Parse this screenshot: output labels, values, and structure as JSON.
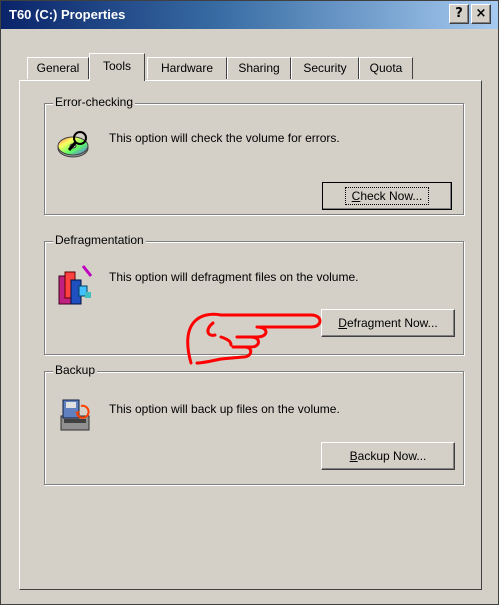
{
  "window": {
    "title": "T60 (C:) Properties"
  },
  "title_buttons": {
    "help": "?",
    "close": "×"
  },
  "tabs": [
    {
      "label": "General"
    },
    {
      "label": "Tools"
    },
    {
      "label": "Hardware"
    },
    {
      "label": "Sharing"
    },
    {
      "label": "Security"
    },
    {
      "label": "Quota"
    }
  ],
  "error_checking": {
    "legend": "Error-checking",
    "description": "This option will check the volume for errors.",
    "button_accel": "C",
    "button_rest": "heck Now..."
  },
  "defrag": {
    "legend": "Defragmentation",
    "description": "This option will defragment files on the volume.",
    "button_accel": "D",
    "button_rest": "efragment Now..."
  },
  "backup": {
    "legend": "Backup",
    "description": "This option will back up files on the volume.",
    "button_accel": "B",
    "button_rest": "ackup Now..."
  },
  "icons": {
    "error_checking": "disk-check-icon",
    "defrag": "defrag-icon",
    "backup": "backup-icon",
    "pointer": "hand-pointer-annotation"
  },
  "colors": {
    "face": "#d4d0c8",
    "title_start": "#0a246a",
    "title_end": "#a6caf0",
    "annotation": "#ff0000"
  }
}
